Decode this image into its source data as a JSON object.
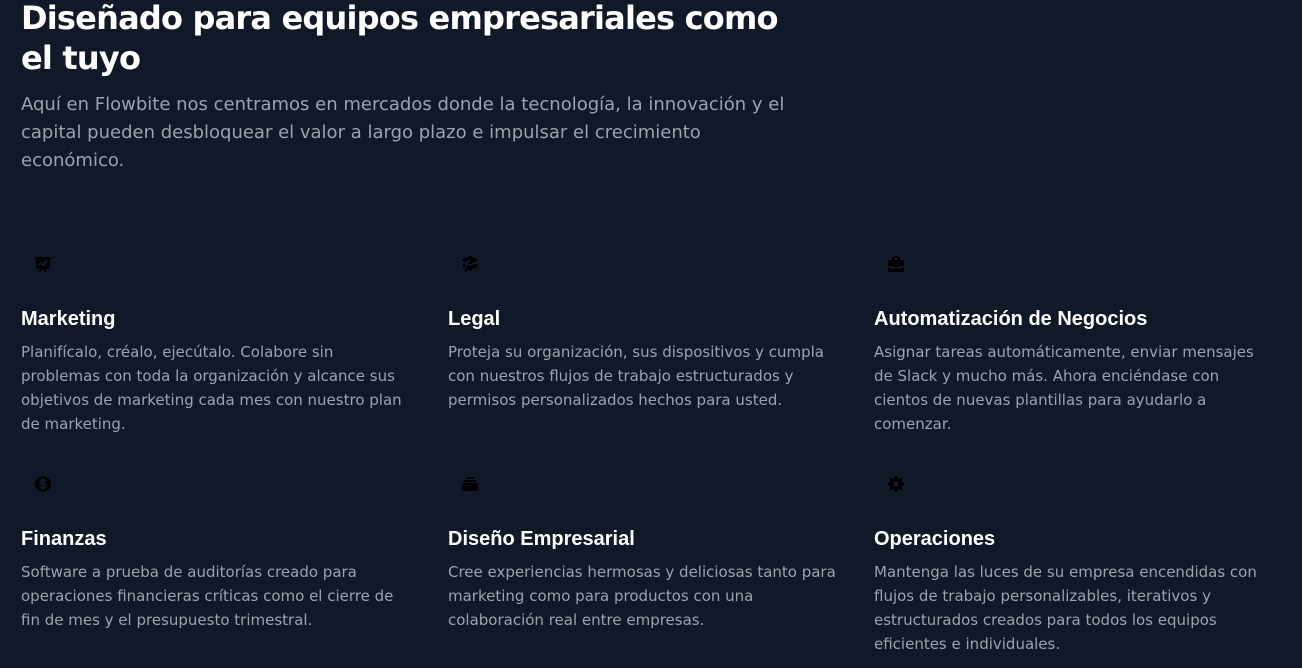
{
  "hero": {
    "title": "Diseñado para equipos empresariales como el tuyo",
    "description": "Aquí en Flowbite nos centramos en mercados donde la tecnología, la innovación y el capital pueden desbloquear el valor a largo plazo e impulsar el crecimiento económico."
  },
  "features": [
    {
      "icon": "presentation-chart-icon",
      "title": "Marketing",
      "description": "Planifícalo, créalo, ejecútalo. Colabore sin problemas con toda la organización y alcance sus objetivos de marketing cada mes con nuestro plan de marketing."
    },
    {
      "icon": "graduation-cap-icon",
      "title": "Legal",
      "description": "Proteja su organización, sus dispositivos y cumpla con nuestros flujos de trabajo estructurados y permisos personalizados hechos para usted."
    },
    {
      "icon": "briefcase-icon",
      "title": "Automatización de Negocios",
      "description": "Asignar tareas automáticamente, enviar mensajes de Slack y mucho más. Ahora enciéndase con cientos de nuevas plantillas para ayudarlo a comenzar."
    },
    {
      "icon": "currency-dollar-icon",
      "title": "Finanzas",
      "description": "Software a prueba de auditorías creado para operaciones financieras críticas como el cierre de fin de mes y el presupuesto trimestral."
    },
    {
      "icon": "collection-stack-icon",
      "title": "Diseño Empresarial",
      "description": "Cree experiencias hermosas y deliciosas tanto para marketing como para productos con una colaboración real entre empresas."
    },
    {
      "icon": "cog-icon",
      "title": "Operaciones",
      "description": "Mantenga las luces de su empresa encendidas con flujos de trabajo personalizables, iterativos y estructurados creados para todos los equipos eficientes e individuales."
    }
  ],
  "colors": {
    "background": "#111827",
    "heading": "#ffffff",
    "body_text": "#9ca3af",
    "icon": "#000000"
  }
}
